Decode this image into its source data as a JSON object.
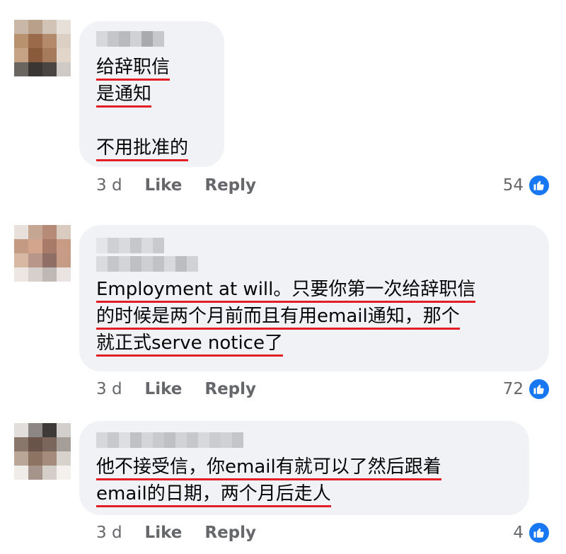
{
  "comments": [
    {
      "lines": [
        "给辞职信",
        "是通知",
        "",
        "不用批准的"
      ],
      "time": "3 d",
      "like_label": "Like",
      "reply_label": "Reply",
      "reaction_count": "54"
    },
    {
      "lines": [
        "Employment at will。只要你第一次给辞职信",
        "的时候是两个月前而且有用email通知，那个",
        "就正式serve notice了"
      ],
      "time": "3 d",
      "like_label": "Like",
      "reply_label": "Reply",
      "reaction_count": "72"
    },
    {
      "lines": [
        "他不接受信，你email有就可以了然后跟着",
        "email的日期，两个月后走人"
      ],
      "time": "3 d",
      "like_label": "Like",
      "reply_label": "Reply",
      "reaction_count": "4"
    }
  ],
  "icons": {
    "reaction": "thumbs-up-icon"
  },
  "colors": {
    "underline": "#e41e26",
    "like_blue": "#1877f2",
    "bubble": "#f0f2f5",
    "meta": "#65676b"
  }
}
